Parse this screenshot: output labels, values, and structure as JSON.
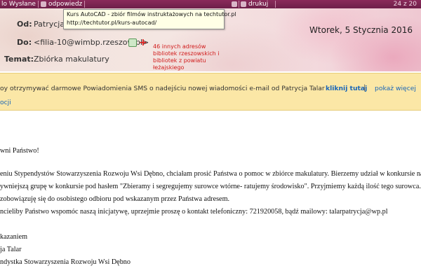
{
  "toolbar": {
    "items": [
      "lo Wysłane",
      "odpowiedz",
      "",
      "",
      "drukuj"
    ],
    "page_indicator": "24 z 20"
  },
  "tooltip": {
    "title": "Kurs AutoCAD - zbiór filmów instruktażowych na techtutor.pl",
    "url": "http://techtutor.pl/kurs-autocad/"
  },
  "header": {
    "from_label": "Od:",
    "from_value": "Patrycja T",
    "date": "Wtorek, 5 Stycznia 2016",
    "to_label": "Do:",
    "to_value": "<filia-10@wimbp.rzeszow.pl>",
    "subject_label": "Temat:",
    "subject_value": "Zbiórka makulatury",
    "annotation": [
      "46 innych adresów",
      "bibliotek rzeszowskich i",
      "bibliotek z powiatu",
      "łeżajskiego"
    ]
  },
  "sms": {
    "text": "oy otrzymywać darmowe Powiadomienia SMS o nadejściu nowej wiadomości e-mail od Patrycja Talar",
    "click_link": "kliknij tutaj",
    "separator": "|",
    "more_link": "pokaż więcej",
    "more_cont": "ocji"
  },
  "body": {
    "lines": [
      "wni Państwo!",
      "eniu Stypendystów Stowarzyszenia Rozwoju Wsi Dębno, chciałam prosić Państwa o pomoc w zbiórce makulatury. Bierzemy udział w konkursie na",
      "ywniejszą grupę w konkursie  pod hasłem \"Zbieramy i segregujemy surowce wtórne- ratujemy środowisko\". Przyjmiemy każdą ilość tego surowca. Ty",
      " zobowiązuję się do osobistego odbioru pod wskazanym przez Państwa adresem.",
      "ncieliby Państwo wspomóc naszą inicjatywę, uprzejmie proszę o kontakt telefoniczny: 721920058, bądź mailowy: talarpatrycja@wp.pl",
      "kazaniem",
      "ja Talar",
      "ndystka Stowarzyszenia Rozwoju Wsi Dębno"
    ]
  },
  "colors": {
    "toolbar": "#7a2452",
    "sms_bar": "#fbe7a6",
    "link": "#1a66b8",
    "annotation": "#d01a1a"
  }
}
